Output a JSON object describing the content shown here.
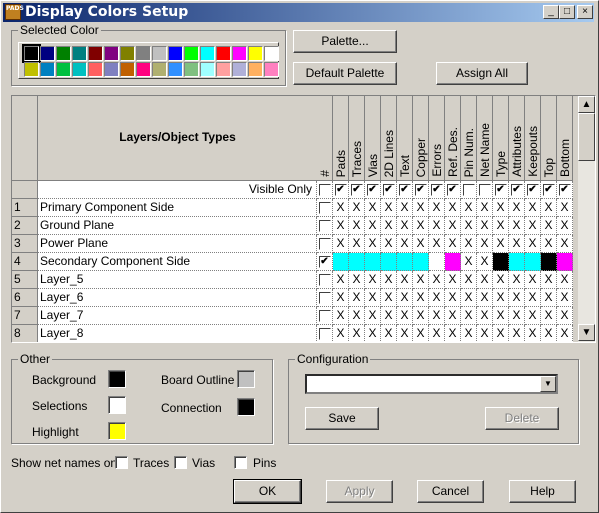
{
  "window": {
    "title": "Display Colors Setup",
    "min": "_",
    "max": "□",
    "close": "×"
  },
  "selected_color": {
    "label": "Selected Color",
    "palette": [
      "#000000",
      "#000080",
      "#008000",
      "#008080",
      "#800000",
      "#800080",
      "#808000",
      "#808080",
      "#c0c0c0",
      "#0000ff",
      "#00ff00",
      "#00ffff",
      "#ff0000",
      "#ff00ff",
      "#ffff00",
      "#ffffff",
      "#c0c000",
      "#0080c0",
      "#00c040",
      "#00c0c0",
      "#ff6060",
      "#8080c0",
      "#c06000",
      "#ff0080",
      "#b0b070",
      "#3090ff",
      "#80c080",
      "#a0ffff",
      "#ffa0a0",
      "#b0b0d8",
      "#ffb060",
      "#ff80c0"
    ],
    "selected_index": 0
  },
  "buttons": {
    "palette": "Palette...",
    "default_palette": "Default Palette",
    "assign_all": "Assign All",
    "save": "Save",
    "delete": "Delete",
    "ok": "OK",
    "apply": "Apply",
    "cancel": "Cancel",
    "help": "Help"
  },
  "grid": {
    "header_title": "Layers/Object Types",
    "hash": "#",
    "columns": [
      "Pads",
      "Traces",
      "Vias",
      "2D Lines",
      "Text",
      "Copper",
      "Errors",
      "Ref. Des.",
      "Pin Num.",
      "Net Name",
      "Type",
      "Attributes",
      "Keepouts",
      "Top",
      "Bottom"
    ],
    "visible_only": {
      "label": "Visible Only",
      "hash_checked": false,
      "checked": [
        true,
        true,
        true,
        true,
        true,
        true,
        true,
        true,
        false,
        false,
        true,
        true,
        true,
        true,
        true
      ]
    },
    "rows": [
      {
        "num": "1",
        "name": "Primary Component Side",
        "checked": false,
        "cells": [
          "X",
          "X",
          "X",
          "X",
          "X",
          "X",
          "X",
          "X",
          "X",
          "X",
          "X",
          "X",
          "X",
          "X",
          "X"
        ]
      },
      {
        "num": "2",
        "name": "Ground Plane",
        "checked": false,
        "cells": [
          "X",
          "X",
          "X",
          "X",
          "X",
          "X",
          "X",
          "X",
          "X",
          "X",
          "X",
          "X",
          "X",
          "X",
          "X"
        ]
      },
      {
        "num": "3",
        "name": "Power Plane",
        "checked": false,
        "cells": [
          "X",
          "X",
          "X",
          "X",
          "X",
          "X",
          "X",
          "X",
          "X",
          "X",
          "X",
          "X",
          "X",
          "X",
          "X"
        ]
      },
      {
        "num": "4",
        "name": "Secondary Component Side",
        "checked": true,
        "cells": [
          "#00ffff",
          "#00ffff",
          "#00ffff",
          "#00ffff",
          "#00ffff",
          "#00ffff",
          "#ffffff",
          "#ff00ff",
          "X",
          "X",
          "#000000",
          "#00ffff",
          "#00ffff",
          "#000000",
          "#ff00ff"
        ]
      },
      {
        "num": "5",
        "name": "Layer_5",
        "checked": false,
        "cells": [
          "X",
          "X",
          "X",
          "X",
          "X",
          "X",
          "X",
          "X",
          "X",
          "X",
          "X",
          "X",
          "X",
          "X",
          "X"
        ]
      },
      {
        "num": "6",
        "name": "Layer_6",
        "checked": false,
        "cells": [
          "X",
          "X",
          "X",
          "X",
          "X",
          "X",
          "X",
          "X",
          "X",
          "X",
          "X",
          "X",
          "X",
          "X",
          "X"
        ]
      },
      {
        "num": "7",
        "name": "Layer_7",
        "checked": false,
        "cells": [
          "X",
          "X",
          "X",
          "X",
          "X",
          "X",
          "X",
          "X",
          "X",
          "X",
          "X",
          "X",
          "X",
          "X",
          "X"
        ]
      },
      {
        "num": "8",
        "name": "Layer_8",
        "checked": false,
        "cells": [
          "X",
          "X",
          "X",
          "X",
          "X",
          "X",
          "X",
          "X",
          "X",
          "X",
          "X",
          "X",
          "X",
          "X",
          "X"
        ]
      }
    ]
  },
  "other": {
    "label": "Other",
    "background": {
      "label": "Background",
      "color": "#000000"
    },
    "selections": {
      "label": "Selections",
      "color": "#ffffff"
    },
    "highlight": {
      "label": "Highlight",
      "color": "#ffff00"
    },
    "board_outline": {
      "label": "Board Outline",
      "color": "#c0c0c0"
    },
    "connection": {
      "label": "Connection",
      "color": "#000000"
    }
  },
  "configuration": {
    "label": "Configuration",
    "value": ""
  },
  "net_names": {
    "label": "Show net names on",
    "traces": "Traces",
    "vias": "Vias",
    "pins": "Pins"
  }
}
